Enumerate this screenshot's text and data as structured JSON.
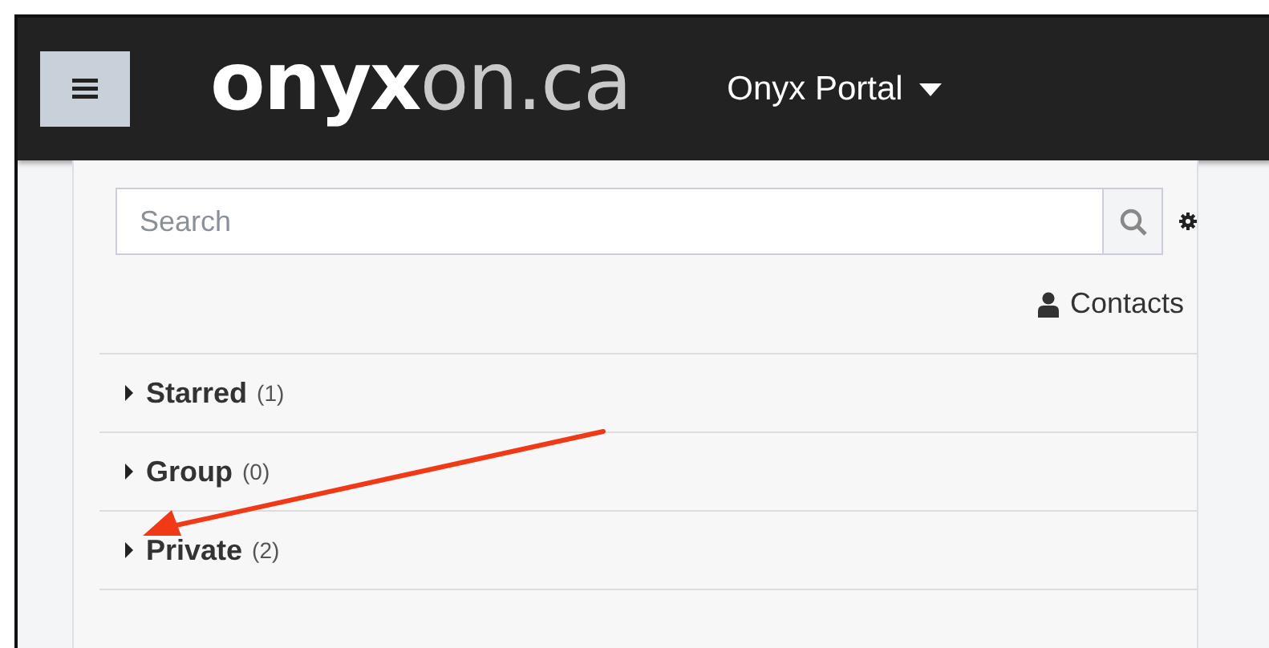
{
  "header": {
    "logo": {
      "primary": "onyx",
      "secondary": "on.ca"
    },
    "menu_title": "Onyx Portal"
  },
  "search": {
    "placeholder": "Search"
  },
  "contacts_link": "Contacts",
  "groups": [
    {
      "label": "Starred",
      "count": "(1)",
      "expanded": false
    },
    {
      "label": "Group",
      "count": "(0)",
      "expanded": false
    },
    {
      "label": "Private",
      "count": "(2)",
      "expanded": false
    }
  ]
}
